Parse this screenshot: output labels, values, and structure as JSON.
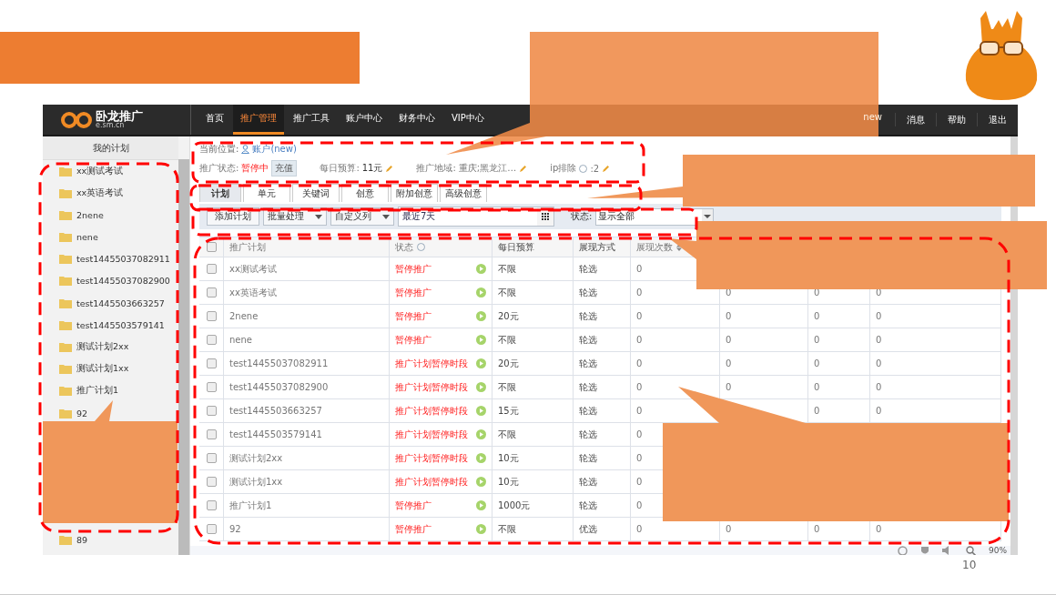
{
  "slide": {
    "page_number": "10"
  },
  "nav": {
    "logo_text": "卧龙推广",
    "logo_domain": "e.sm.cn",
    "items": [
      {
        "label": "首页",
        "selected": false
      },
      {
        "label": "推广管理",
        "selected": true
      },
      {
        "label": "推广工具",
        "selected": false
      },
      {
        "label": "账户中心",
        "selected": false
      },
      {
        "label": "财务中心",
        "selected": false
      },
      {
        "label": "VIP中心",
        "selected": false
      }
    ],
    "badge": "new",
    "right_items": [
      "消息",
      "帮助",
      "退出"
    ]
  },
  "sidebar": {
    "title": "我的计划",
    "items": [
      "xx测试考试",
      "xx英语考试",
      "2nene",
      "nene",
      "test14455037082911",
      "test14455037082900",
      "test1445503663257",
      "test1445503579141",
      "测试计划2xx",
      "测试计划1xx",
      "推广计划1",
      "92"
    ],
    "lower_items": [
      "89"
    ]
  },
  "breadcrumb": {
    "label": "当前位置:",
    "link": "账户(new)"
  },
  "summary": {
    "status_label": "推广状态:",
    "status_value": "暂停中",
    "recharge_button": "充值",
    "budget_label": "每日预算:",
    "budget_value": "11元",
    "region_label": "推广地域:",
    "region_value": "重庆;黑龙江…",
    "ip_label": "ip排除",
    "ip_value": ":2"
  },
  "tabs": [
    {
      "label": "计划",
      "selected": true
    },
    {
      "label": "单元",
      "selected": false
    },
    {
      "label": "关键词",
      "selected": false
    },
    {
      "label": "创意",
      "selected": false
    },
    {
      "label": "附加创意",
      "selected": false
    },
    {
      "label": "高级创意",
      "selected": false
    }
  ],
  "toolbar": {
    "add_button": "添加计划",
    "batch_dropdown": "批量处理",
    "columns_dropdown": "自定义列",
    "date_range": "最近7天",
    "status_label": "状态:",
    "status_select": "显示全部"
  },
  "table": {
    "select_all_checked": false,
    "columns": [
      "推广计划",
      "状态",
      "每日预算",
      "展现方式",
      "展现次数"
    ],
    "rows": [
      {
        "checked": false,
        "plan": "xx测试考试",
        "status": "暂停推广",
        "budget": "不限",
        "display_mode": "轮选",
        "impressions": "0"
      },
      {
        "checked": false,
        "plan": "xx英语考试",
        "status": "暂停推广",
        "budget": "不限",
        "display_mode": "轮选",
        "impressions": "0",
        "column_7": "0",
        "column_8": "0",
        "column_9": "0"
      },
      {
        "checked": false,
        "plan": "2nene",
        "status": "暂停推广",
        "budget": "20元",
        "display_mode": "轮选",
        "impressions": "0",
        "column_7": "0",
        "column_8": "0",
        "column_9": "0"
      },
      {
        "checked": false,
        "plan": "nene",
        "status": "暂停推广",
        "budget": "不限",
        "display_mode": "轮选",
        "impressions": "0",
        "column_7": "0",
        "column_8": "0",
        "column_9": "0"
      },
      {
        "checked": false,
        "plan": "test14455037082911",
        "status": "推广计划暂停时段",
        "budget": "20元",
        "display_mode": "轮选",
        "impressions": "0",
        "column_7": "0",
        "column_8": "0",
        "column_9": "0"
      },
      {
        "checked": false,
        "plan": "test14455037082900",
        "status": "推广计划暂停时段",
        "budget": "不限",
        "display_mode": "轮选",
        "impressions": "0",
        "column_7": "0",
        "column_8": "0",
        "column_9": "0"
      },
      {
        "checked": false,
        "plan": "test1445503663257",
        "status": "推广计划暂停时段",
        "budget": "15元",
        "display_mode": "轮选",
        "impressions": "0",
        "column_8": "0",
        "column_9": "0"
      },
      {
        "checked": false,
        "plan": "test1445503579141",
        "status": "推广计划暂停时段",
        "budget": "不限",
        "display_mode": "轮选",
        "impressions": "0"
      },
      {
        "checked": false,
        "plan": "测试计划2xx",
        "status": "推广计划暂停时段",
        "budget": "10元",
        "display_mode": "轮选",
        "impressions": "0"
      },
      {
        "checked": false,
        "plan": "测试计划1xx",
        "status": "推广计划暂停时段",
        "budget": "10元",
        "display_mode": "轮选",
        "impressions": "0"
      },
      {
        "checked": false,
        "plan": "推广计划1",
        "status": "暂停推广",
        "budget": "1000元",
        "display_mode": "轮选",
        "impressions": "0"
      },
      {
        "checked": false,
        "plan": "92",
        "status": "暂停推广",
        "budget": "不限",
        "display_mode": "优选",
        "impressions": "0",
        "column_7": "0",
        "column_8": "0",
        "column_9": "0"
      }
    ]
  },
  "status_bar": {
    "zoom": "90%"
  }
}
